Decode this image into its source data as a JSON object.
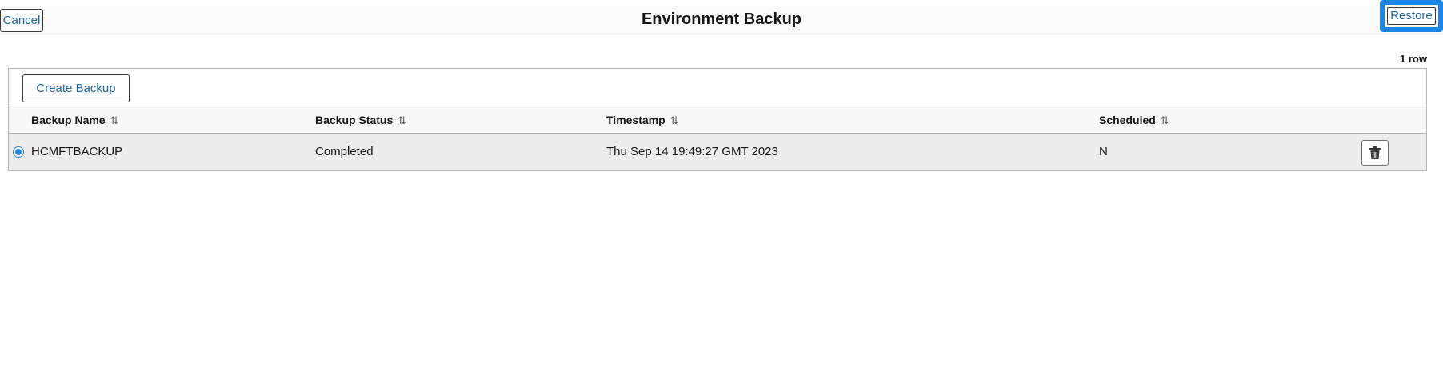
{
  "header": {
    "title": "Environment Backup",
    "cancel_label": "Cancel",
    "restore_label": "Restore"
  },
  "grid": {
    "row_count": "1 row",
    "create_label": "Create Backup",
    "columns": [
      "Backup Name",
      "Backup Status",
      "Timestamp",
      "Scheduled"
    ],
    "sort_glyph": "⇅",
    "rows": [
      {
        "backup_name": "HCMFTBACKUP",
        "backup_status": "Completed",
        "timestamp": "Thu Sep 14 19:49:27 GMT 2023",
        "scheduled": "N",
        "selected": true
      }
    ]
  },
  "icons": {
    "delete": "trash-icon",
    "sort": "sort-arrows-icon",
    "select": "radio-icon"
  },
  "colors": {
    "link": "#1f64a8",
    "focus": "#1a86e8",
    "row_bg": "#efedeb"
  }
}
